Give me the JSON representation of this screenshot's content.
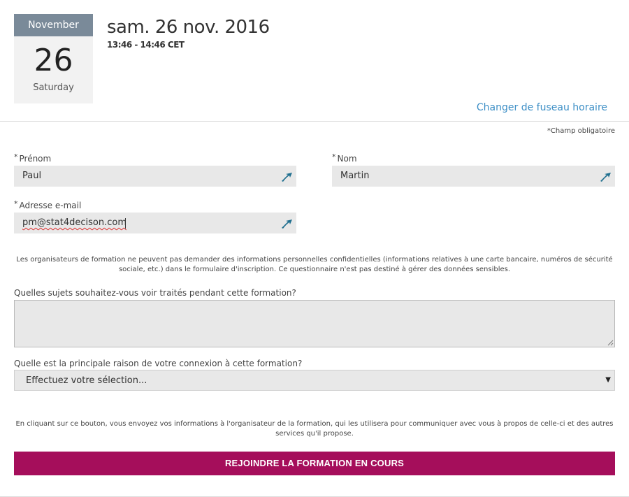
{
  "calendar": {
    "month": "November",
    "day": "26",
    "weekday": "Saturday"
  },
  "event": {
    "date": "sam. 26 nov. 2016",
    "time": "13:46 - 14:46 CET"
  },
  "timezone_link": "Changer de fuseau horaire",
  "required_note": "*Champ obligatoire",
  "form": {
    "required_marker": "*",
    "first_name": {
      "label": "Prénom",
      "value": "Paul"
    },
    "last_name": {
      "label": "Nom",
      "value": "Martin"
    },
    "email": {
      "label": "Adresse e-mail",
      "value": "pm@stat4decison.com"
    },
    "privacy_notice": "Les organisateurs de formation ne peuvent pas demander des informations personnelles confidentielles (informations relatives à une carte bancaire, numéros de sécurité sociale, etc.) dans le formulaire d'inscription. Ce questionnaire n'est pas destiné à gérer des données sensibles.",
    "topics_question": "Quelles sujets souhaitez-vous voir traités pendant cette formation?",
    "reason_question": "Quelle est la principale raison de votre connexion à cette formation?",
    "reason_selected": "Effectuez votre sélection...",
    "consent_notice": "En cliquant sur ce bouton, vous envoyez vos informations à l'organisateur de la formation, qui les utilisera pour communiquer avec vous à propos de celle-ci et des autres services qu'il propose.",
    "submit_label": "REJOINDRE LA FORMATION EN COURS"
  },
  "colors": {
    "accent": "#a50e5b",
    "link": "#3d8fc6",
    "calendar_header": "#7a8a99",
    "autofill_icon": "#1f6f8f"
  },
  "icons": {
    "autofill": "autofill-icon",
    "dropdown": "dropdown-arrow-icon",
    "resize": "resize-grip-icon"
  }
}
